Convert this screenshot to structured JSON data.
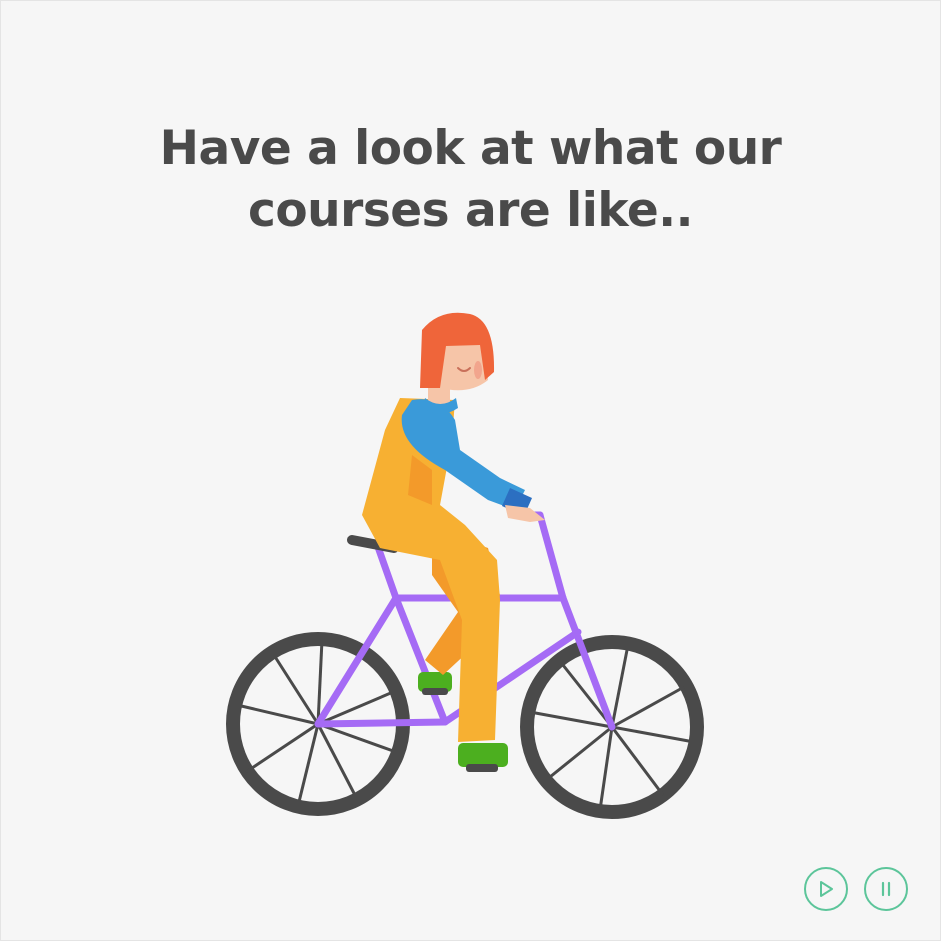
{
  "headline": {
    "line1": "Have a look at what our",
    "line2": "courses are like.."
  },
  "illustration": {
    "subject": "cyclist-on-bicycle",
    "colors": {
      "hair": "#ef653a",
      "skin": "#f6c5a8",
      "overalls": "#f7b032",
      "overalls_shade": "#f39a2a",
      "shirt": "#3a9ad9",
      "cuff": "#2c6fc1",
      "frame": "#a56bf5",
      "tire": "#4a4a4a",
      "shoes": "#4caf1f"
    }
  },
  "controls": {
    "accent": "#5cc59a",
    "play_icon": "play-icon",
    "pause_icon": "pause-icon"
  }
}
